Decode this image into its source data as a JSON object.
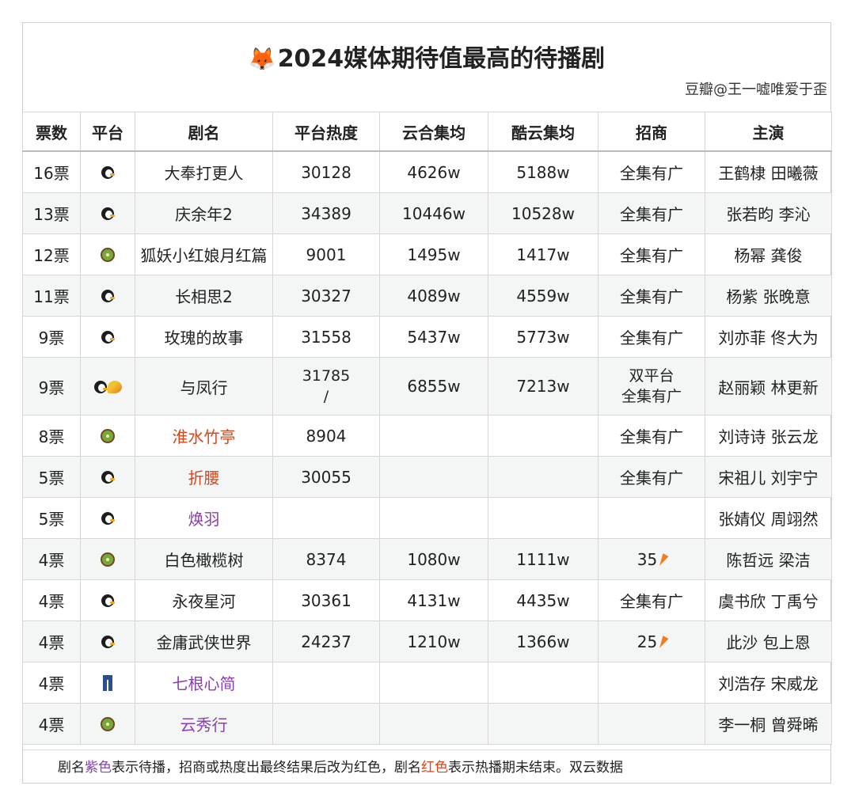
{
  "title": {
    "emoji": "🦊",
    "text": "2024媒体期待值最高的待播剧",
    "credit": "豆瓣@王一嘘唯爱于歪"
  },
  "colors": {
    "purple": "#8a3fb0",
    "red": "#d8451b",
    "alt_row": "#f3f6f5"
  },
  "headers": [
    "票数",
    "平台",
    "剧名",
    "平台热度",
    "云合集均",
    "酷云集均",
    "招商",
    "主演"
  ],
  "rows": [
    {
      "votes": "16票",
      "platform": "penguin-icon",
      "drama": "大奉打更人",
      "heat": "30128",
      "heat2": "",
      "yunhe": "4626w",
      "kuyun": "5188w",
      "ads": "全集有广",
      "ads2": "",
      "cast": "王鹤棣 田曦薇"
    },
    {
      "votes": "13票",
      "platform": "penguin-icon",
      "drama": "庆余年2",
      "heat": "34389",
      "heat2": "",
      "yunhe": "10446w",
      "kuyun": "10528w",
      "ads": "全集有广",
      "ads2": "",
      "cast": "张若昀 李沁"
    },
    {
      "votes": "12票",
      "platform": "kiwi-icon",
      "drama": "狐妖小红娘月红篇",
      "heat": "9001",
      "heat2": "",
      "yunhe": "1495w",
      "kuyun": "1417w",
      "ads": "全集有广",
      "ads2": "",
      "cast": "杨幂 龚俊"
    },
    {
      "votes": "11票",
      "platform": "penguin-icon",
      "drama": "长相思2",
      "heat": "30327",
      "heat2": "",
      "yunhe": "4089w",
      "kuyun": "4559w",
      "ads": "全集有广",
      "ads2": "",
      "cast": "杨紫 张晚意"
    },
    {
      "votes": "9票",
      "platform": "penguin-icon",
      "drama": "玫瑰的故事",
      "heat": "31558",
      "heat2": "",
      "yunhe": "5437w",
      "kuyun": "5773w",
      "ads": "全集有广",
      "ads2": "",
      "cast": "刘亦菲 佟大为"
    },
    {
      "votes": "9票",
      "platform": "penguin-mango-icon",
      "drama": "与凤行",
      "heat": "31785",
      "heat2": "/",
      "yunhe": "6855w",
      "kuyun": "7213w",
      "ads": "双平台",
      "ads2": "全集有广",
      "cast": "赵丽颖 林更新"
    },
    {
      "votes": "8票",
      "platform": "kiwi-icon",
      "drama": "淮水竹亭",
      "heat": "8904",
      "heat2": "",
      "yunhe": "",
      "kuyun": "",
      "ads": "全集有广",
      "ads2": "",
      "cast": "刘诗诗 张云龙"
    },
    {
      "votes": "5票",
      "platform": "penguin-icon",
      "drama": "折腰",
      "heat": "30055",
      "heat2": "",
      "yunhe": "",
      "kuyun": "",
      "ads": "全集有广",
      "ads2": "",
      "cast": "宋祖儿 刘宇宁"
    },
    {
      "votes": "5票",
      "platform": "penguin-icon",
      "drama": "焕羽",
      "heat": "",
      "heat2": "",
      "yunhe": "",
      "kuyun": "",
      "ads": "",
      "ads2": "",
      "cast": "张婧仪 周翊然"
    },
    {
      "votes": "4票",
      "platform": "kiwi-icon",
      "drama": "白色橄榄树",
      "heat": "8374",
      "heat2": "",
      "yunhe": "1080w",
      "kuyun": "1111w",
      "ads": "35",
      "ads2": "",
      "cast": "陈哲远 梁洁"
    },
    {
      "votes": "4票",
      "platform": "penguin-icon",
      "drama": "永夜星河",
      "heat": "30361",
      "heat2": "",
      "yunhe": "4131w",
      "kuyun": "4435w",
      "ads": "全集有广",
      "ads2": "",
      "cast": "虞书欣 丁禹兮"
    },
    {
      "votes": "4票",
      "platform": "penguin-icon",
      "drama": "金庸武侠世界",
      "heat": "24237",
      "heat2": "",
      "yunhe": "1210w",
      "kuyun": "1366w",
      "ads": "25",
      "ads2": "",
      "cast": "此沙 包上恩"
    },
    {
      "votes": "4票",
      "platform": "jeans-icon",
      "drama": "七根心简",
      "heat": "",
      "heat2": "",
      "yunhe": "",
      "kuyun": "",
      "ads": "",
      "ads2": "",
      "cast": "刘浩存 宋威龙"
    },
    {
      "votes": "4票",
      "platform": "kiwi-icon",
      "drama": "云秀行",
      "heat": "",
      "heat2": "",
      "yunhe": "",
      "kuyun": "",
      "ads": "",
      "ads2": "",
      "cast": "李一桐 曾舜晞"
    }
  ],
  "footer": {
    "p1": "剧名",
    "purple_word": "紫色",
    "p2": "表示待播，招商或热度出最终结果后改为红色，剧名",
    "red_word": "红色",
    "p3": "表示热播期未结束。双云数据"
  }
}
